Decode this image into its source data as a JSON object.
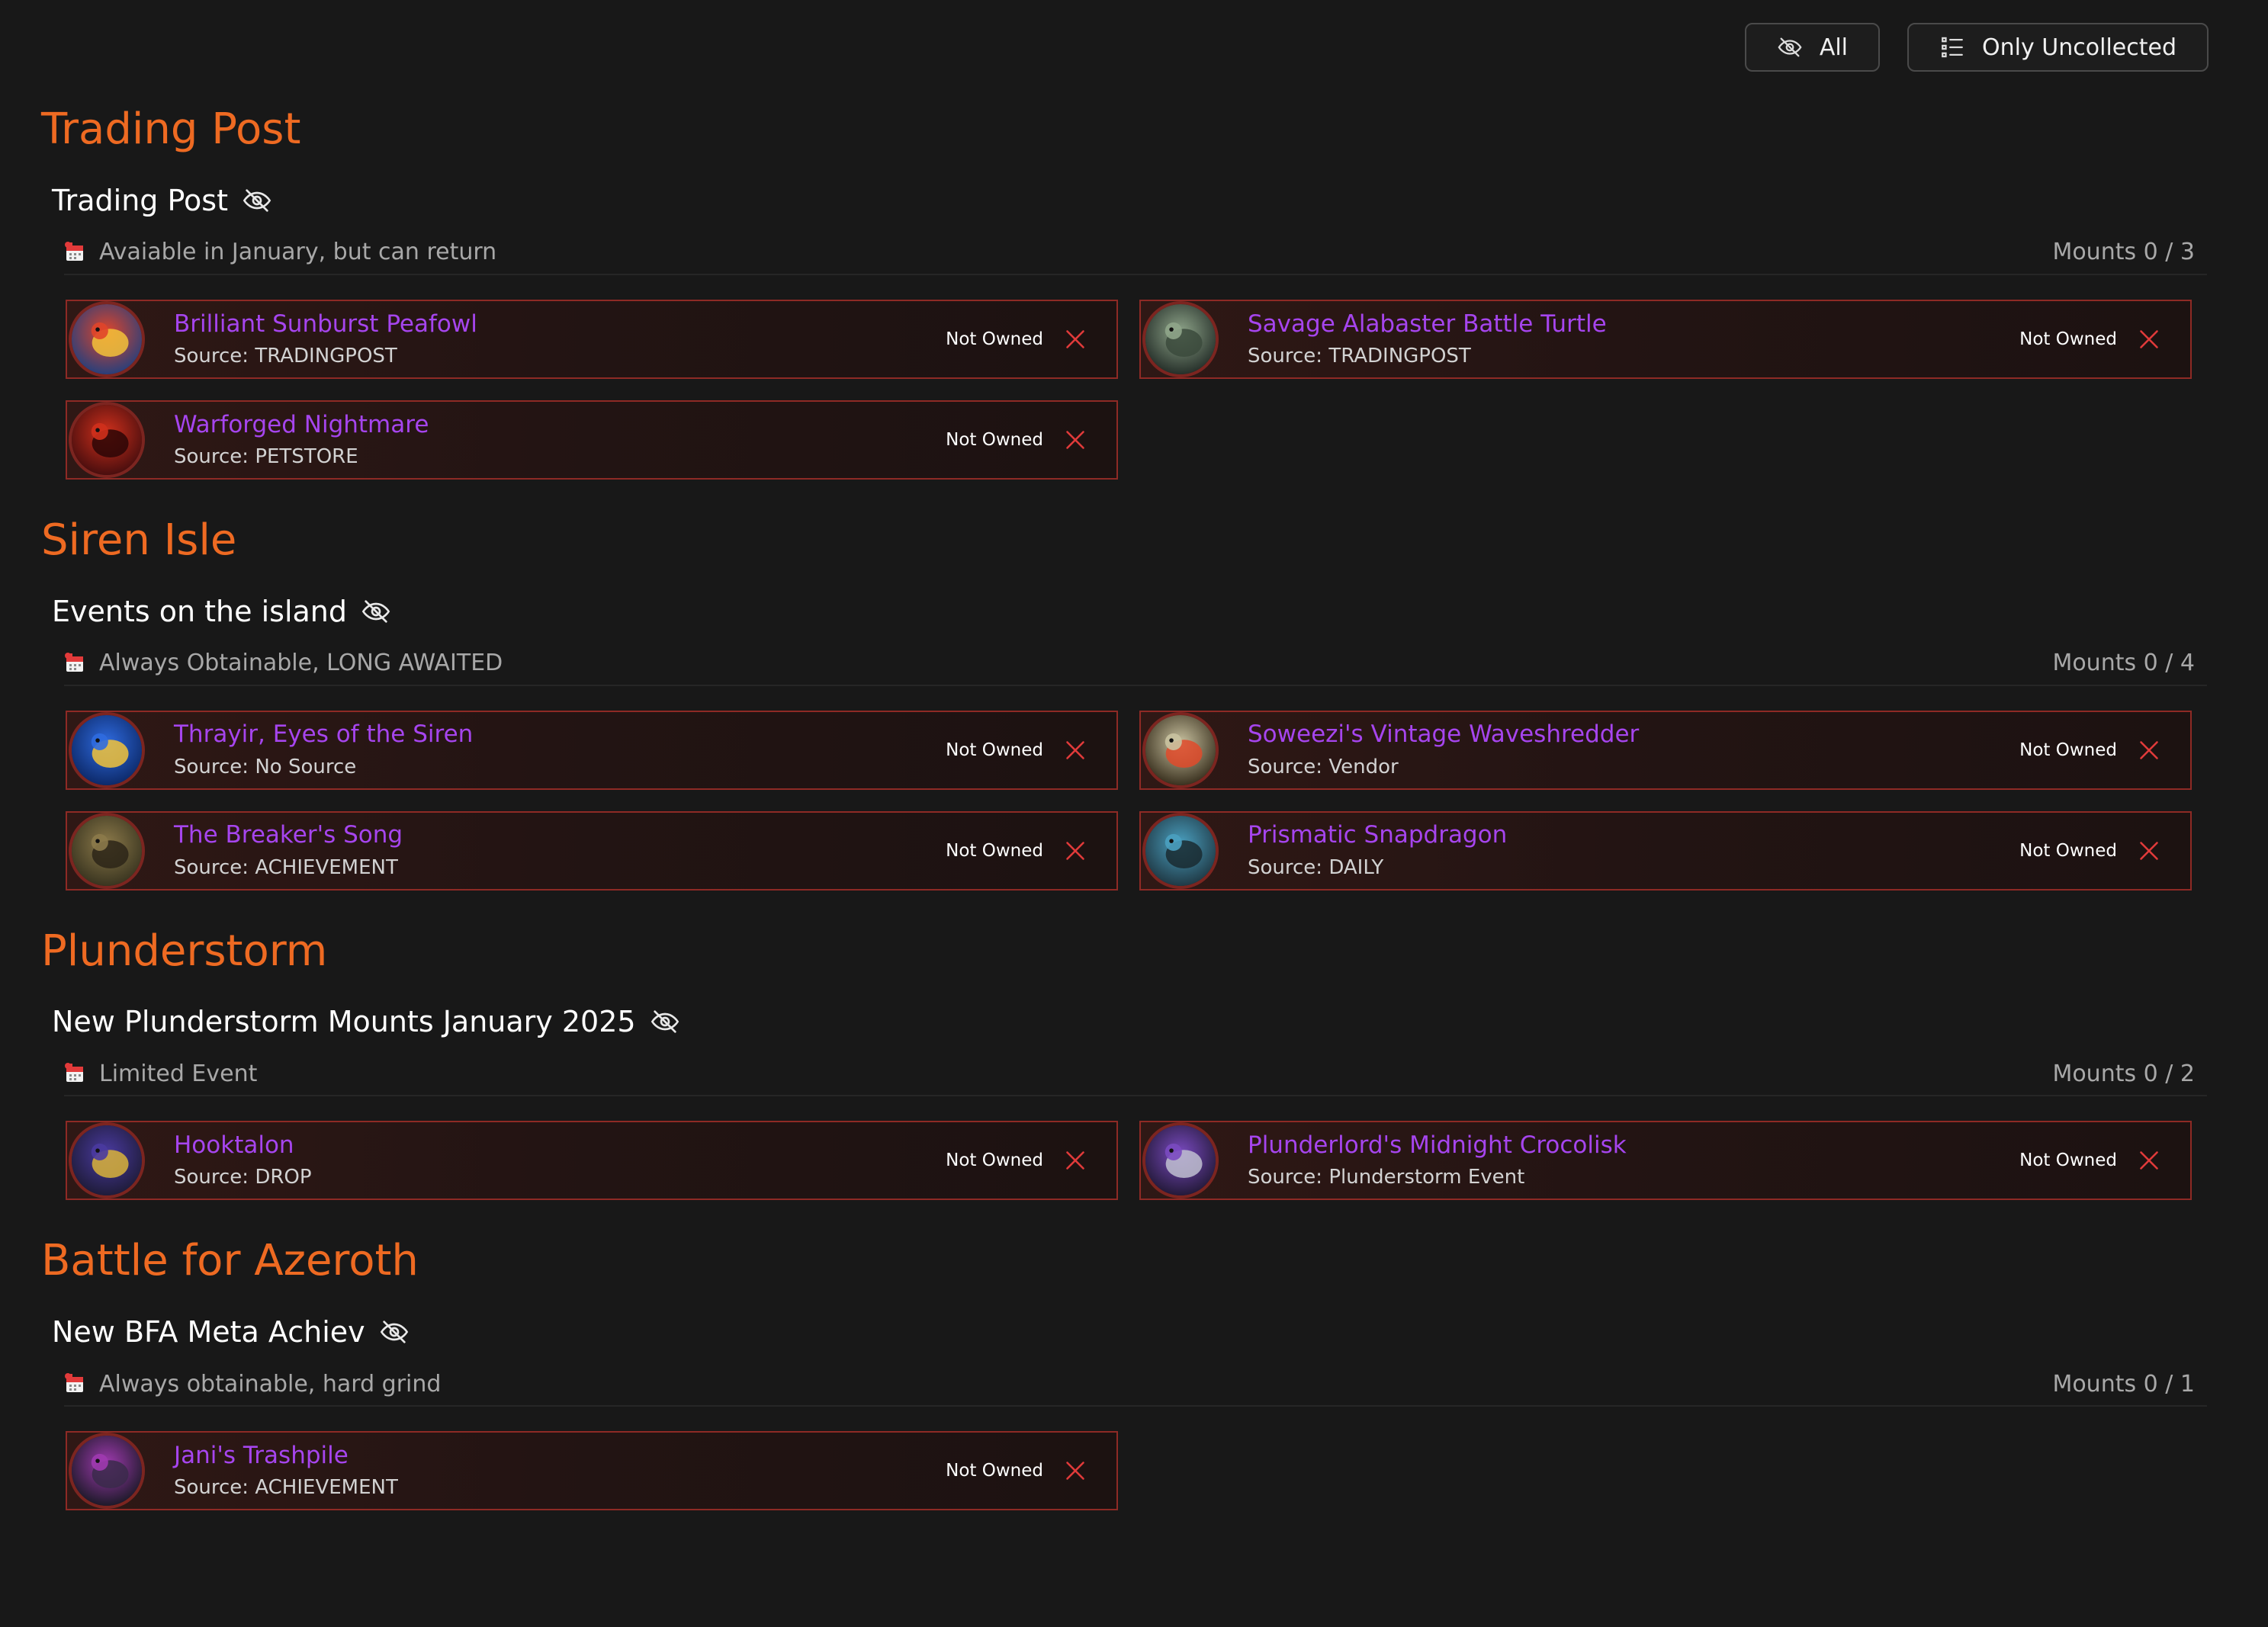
{
  "filters": {
    "all_label": "All",
    "uncollected_label": "Only Uncollected"
  },
  "categories": [
    {
      "title": "Trading Post",
      "groups": [
        {
          "title": "Trading Post",
          "note": "Avaiable in January, but can return",
          "count": "Mounts 0 / 3",
          "mounts": [
            {
              "name": "Brilliant Sunburst Peafowl",
              "source": "Source: TRADINGPOST",
              "status": "Not Owned"
            },
            {
              "name": "Savage Alabaster Battle Turtle",
              "source": "Source: TRADINGPOST",
              "status": "Not Owned"
            },
            {
              "name": "Warforged Nightmare",
              "source": "Source: PETSTORE",
              "status": "Not Owned"
            }
          ]
        }
      ]
    },
    {
      "title": "Siren Isle",
      "groups": [
        {
          "title": "Events on the island",
          "note": "Always Obtainable, LONG AWAITED",
          "count": "Mounts 0 / 4",
          "mounts": [
            {
              "name": "Thrayir, Eyes of the Siren",
              "source": "Source: No Source",
              "status": "Not Owned"
            },
            {
              "name": "Soweezi's Vintage Waveshredder",
              "source": "Source: Vendor",
              "status": "Not Owned"
            },
            {
              "name": "The Breaker's Song",
              "source": "Source: ACHIEVEMENT",
              "status": "Not Owned"
            },
            {
              "name": "Prismatic Snapdragon",
              "source": "Source: DAILY",
              "status": "Not Owned"
            }
          ]
        }
      ]
    },
    {
      "title": "Plunderstorm",
      "groups": [
        {
          "title": "New Plunderstorm Mounts January 2025",
          "note": "Limited Event",
          "count": "Mounts 0 / 2",
          "mounts": [
            {
              "name": "Hooktalon",
              "source": "Source: DROP",
              "status": "Not Owned"
            },
            {
              "name": "Plunderlord's Midnight Crocolisk",
              "source": "Source: Plunderstorm Event",
              "status": "Not Owned"
            }
          ]
        }
      ]
    },
    {
      "title": "Battle for Azeroth",
      "groups": [
        {
          "title": "New BFA Meta Achiev",
          "note": "Always obtainable, hard grind",
          "count": "Mounts 0 / 1",
          "mounts": [
            {
              "name": "Jani's Trashpile",
              "source": "Source: ACHIEVEMENT",
              "status": "Not Owned"
            }
          ]
        }
      ]
    }
  ],
  "colors": {
    "background": "#181818",
    "category_title": "#ee6a22",
    "mount_name": "#a645ee",
    "card_border": "#8e2a25",
    "not_owned_x": "#e03a3a"
  },
  "icons": {
    "eye_slash": "eye-slash-icon",
    "list": "list-icon",
    "calendar": "calendar-icon",
    "close": "close-icon"
  }
}
